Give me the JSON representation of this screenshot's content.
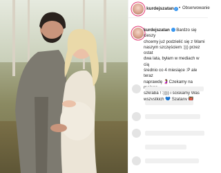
{
  "post": {
    "username": "kurdejszatan",
    "separator": "•",
    "follow_label": "Obserwowanie"
  },
  "caption": {
    "username": "kurdejszatan",
    "lines": [
      "Bardzo się cieszy",
      "chcemy już podzielić się z Wami",
      "naszym szczęściem :))) przez ostat",
      "dwa lata, byłam w mediach w cią",
      "średnio co 4 miesiące :P ale teraz",
      "naprawdę 🤰Czekamy na małego",
      "szkraba ! :)))) i ściskamy Was",
      "wszystkich 💙 Szatany 👹"
    ]
  },
  "icons": {
    "verified": "verified-badge-icon",
    "avatar": "avatar"
  },
  "colors": {
    "verified": "#3897f0",
    "story_ring": "#e1306c"
  }
}
